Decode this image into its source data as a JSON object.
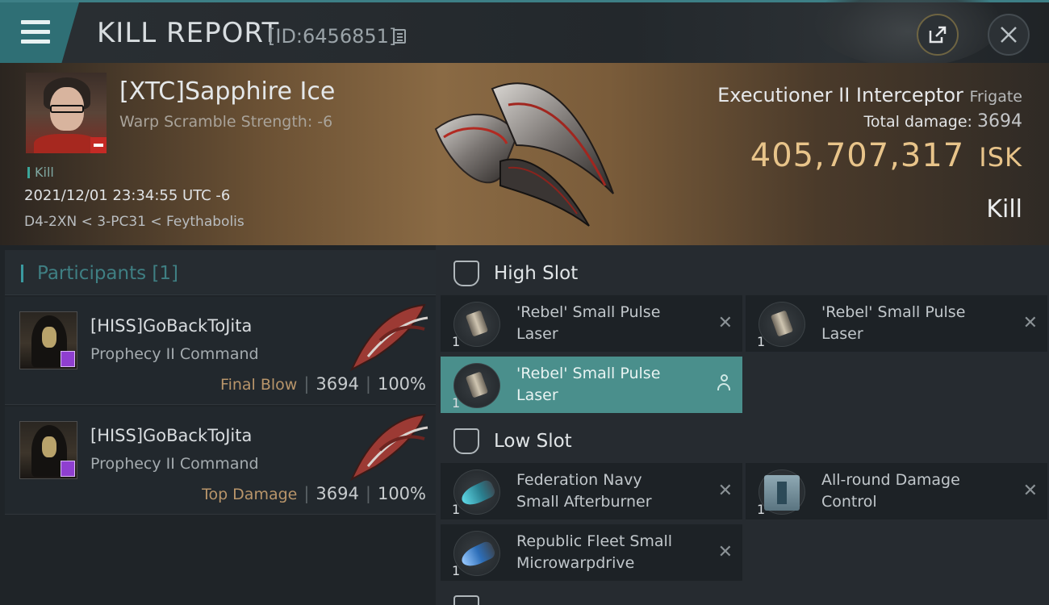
{
  "header": {
    "title": "KILL REPORT",
    "report_id": "[ID:6456851]"
  },
  "victim": {
    "name": "[XTC]Sapphire Ice",
    "warp_scramble": "Warp Scramble Strength: -6",
    "tag": "Kill",
    "datetime": "2021/12/01 23:34:55 UTC -6",
    "location": "D4-2XN < 3-PC31 < Feythabolis",
    "ship_name": "Executioner II Interceptor",
    "ship_class": "Frigate",
    "total_damage_label": "Total damage:",
    "total_damage": "3694",
    "isk_value": "405,707,317",
    "isk_unit": "ISK",
    "result": "Kill"
  },
  "participants": {
    "header": "Participants [1]",
    "rows": [
      {
        "name": "[HISS]GoBackToJita",
        "ship": "Prophecy II Command",
        "role": "Final Blow",
        "damage": "3694",
        "percent": "100%"
      },
      {
        "name": "[HISS]GoBackToJita",
        "ship": "Prophecy II Command",
        "role": "Top Damage",
        "damage": "3694",
        "percent": "100%"
      }
    ]
  },
  "fitting": {
    "high_slot_label": "High Slot",
    "low_slot_label": "Low Slot",
    "high": [
      {
        "line1": "'Rebel' Small Pulse",
        "line2": "Laser",
        "qty": "1"
      },
      {
        "line1": "'Rebel' Small Pulse",
        "line2": "Laser",
        "qty": "1"
      },
      {
        "line1": "'Rebel' Small Pulse",
        "line2": "Laser",
        "qty": "1"
      }
    ],
    "low": [
      {
        "line1": "Federation Navy",
        "line2": "Small Afterburner",
        "qty": "1"
      },
      {
        "line1": "All-round Damage",
        "line2": "Control",
        "qty": "1"
      },
      {
        "line1": "Republic Fleet Small",
        "line2": "Microwarpdrive",
        "qty": "1"
      }
    ]
  },
  "icons": {
    "menu": "menu-icon",
    "copy": "copy-icon",
    "share": "share-icon",
    "close": "close-icon",
    "slot": "slot-icon",
    "remove": "close-icon",
    "person": "person-icon"
  },
  "colors": {
    "accent": "#3a9aa0",
    "isk": "#e8c48a",
    "selected_module": "#4a8f8c",
    "role": "#b8956a"
  }
}
